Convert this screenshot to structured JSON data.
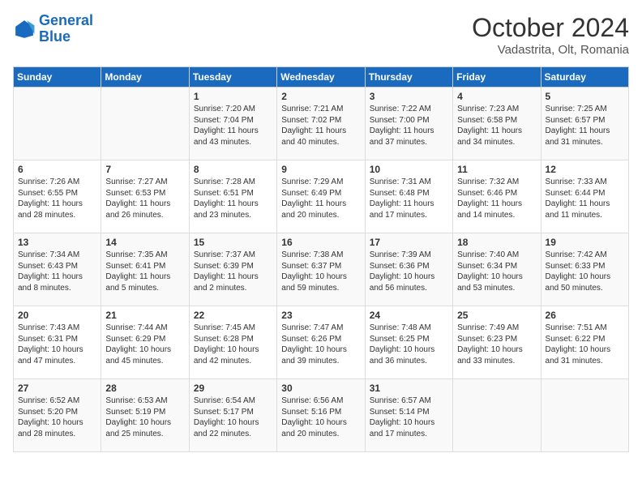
{
  "logo": {
    "line1": "General",
    "line2": "Blue"
  },
  "title": "October 2024",
  "location": "Vadastrita, Olt, Romania",
  "days_of_week": [
    "Sunday",
    "Monday",
    "Tuesday",
    "Wednesday",
    "Thursday",
    "Friday",
    "Saturday"
  ],
  "weeks": [
    [
      {
        "day": "",
        "text": ""
      },
      {
        "day": "",
        "text": ""
      },
      {
        "day": "1",
        "text": "Sunrise: 7:20 AM\nSunset: 7:04 PM\nDaylight: 11 hours and 43 minutes."
      },
      {
        "day": "2",
        "text": "Sunrise: 7:21 AM\nSunset: 7:02 PM\nDaylight: 11 hours and 40 minutes."
      },
      {
        "day": "3",
        "text": "Sunrise: 7:22 AM\nSunset: 7:00 PM\nDaylight: 11 hours and 37 minutes."
      },
      {
        "day": "4",
        "text": "Sunrise: 7:23 AM\nSunset: 6:58 PM\nDaylight: 11 hours and 34 minutes."
      },
      {
        "day": "5",
        "text": "Sunrise: 7:25 AM\nSunset: 6:57 PM\nDaylight: 11 hours and 31 minutes."
      }
    ],
    [
      {
        "day": "6",
        "text": "Sunrise: 7:26 AM\nSunset: 6:55 PM\nDaylight: 11 hours and 28 minutes."
      },
      {
        "day": "7",
        "text": "Sunrise: 7:27 AM\nSunset: 6:53 PM\nDaylight: 11 hours and 26 minutes."
      },
      {
        "day": "8",
        "text": "Sunrise: 7:28 AM\nSunset: 6:51 PM\nDaylight: 11 hours and 23 minutes."
      },
      {
        "day": "9",
        "text": "Sunrise: 7:29 AM\nSunset: 6:49 PM\nDaylight: 11 hours and 20 minutes."
      },
      {
        "day": "10",
        "text": "Sunrise: 7:31 AM\nSunset: 6:48 PM\nDaylight: 11 hours and 17 minutes."
      },
      {
        "day": "11",
        "text": "Sunrise: 7:32 AM\nSunset: 6:46 PM\nDaylight: 11 hours and 14 minutes."
      },
      {
        "day": "12",
        "text": "Sunrise: 7:33 AM\nSunset: 6:44 PM\nDaylight: 11 hours and 11 minutes."
      }
    ],
    [
      {
        "day": "13",
        "text": "Sunrise: 7:34 AM\nSunset: 6:43 PM\nDaylight: 11 hours and 8 minutes."
      },
      {
        "day": "14",
        "text": "Sunrise: 7:35 AM\nSunset: 6:41 PM\nDaylight: 11 hours and 5 minutes."
      },
      {
        "day": "15",
        "text": "Sunrise: 7:37 AM\nSunset: 6:39 PM\nDaylight: 11 hours and 2 minutes."
      },
      {
        "day": "16",
        "text": "Sunrise: 7:38 AM\nSunset: 6:37 PM\nDaylight: 10 hours and 59 minutes."
      },
      {
        "day": "17",
        "text": "Sunrise: 7:39 AM\nSunset: 6:36 PM\nDaylight: 10 hours and 56 minutes."
      },
      {
        "day": "18",
        "text": "Sunrise: 7:40 AM\nSunset: 6:34 PM\nDaylight: 10 hours and 53 minutes."
      },
      {
        "day": "19",
        "text": "Sunrise: 7:42 AM\nSunset: 6:33 PM\nDaylight: 10 hours and 50 minutes."
      }
    ],
    [
      {
        "day": "20",
        "text": "Sunrise: 7:43 AM\nSunset: 6:31 PM\nDaylight: 10 hours and 47 minutes."
      },
      {
        "day": "21",
        "text": "Sunrise: 7:44 AM\nSunset: 6:29 PM\nDaylight: 10 hours and 45 minutes."
      },
      {
        "day": "22",
        "text": "Sunrise: 7:45 AM\nSunset: 6:28 PM\nDaylight: 10 hours and 42 minutes."
      },
      {
        "day": "23",
        "text": "Sunrise: 7:47 AM\nSunset: 6:26 PM\nDaylight: 10 hours and 39 minutes."
      },
      {
        "day": "24",
        "text": "Sunrise: 7:48 AM\nSunset: 6:25 PM\nDaylight: 10 hours and 36 minutes."
      },
      {
        "day": "25",
        "text": "Sunrise: 7:49 AM\nSunset: 6:23 PM\nDaylight: 10 hours and 33 minutes."
      },
      {
        "day": "26",
        "text": "Sunrise: 7:51 AM\nSunset: 6:22 PM\nDaylight: 10 hours and 31 minutes."
      }
    ],
    [
      {
        "day": "27",
        "text": "Sunrise: 6:52 AM\nSunset: 5:20 PM\nDaylight: 10 hours and 28 minutes."
      },
      {
        "day": "28",
        "text": "Sunrise: 6:53 AM\nSunset: 5:19 PM\nDaylight: 10 hours and 25 minutes."
      },
      {
        "day": "29",
        "text": "Sunrise: 6:54 AM\nSunset: 5:17 PM\nDaylight: 10 hours and 22 minutes."
      },
      {
        "day": "30",
        "text": "Sunrise: 6:56 AM\nSunset: 5:16 PM\nDaylight: 10 hours and 20 minutes."
      },
      {
        "day": "31",
        "text": "Sunrise: 6:57 AM\nSunset: 5:14 PM\nDaylight: 10 hours and 17 minutes."
      },
      {
        "day": "",
        "text": ""
      },
      {
        "day": "",
        "text": ""
      }
    ]
  ]
}
